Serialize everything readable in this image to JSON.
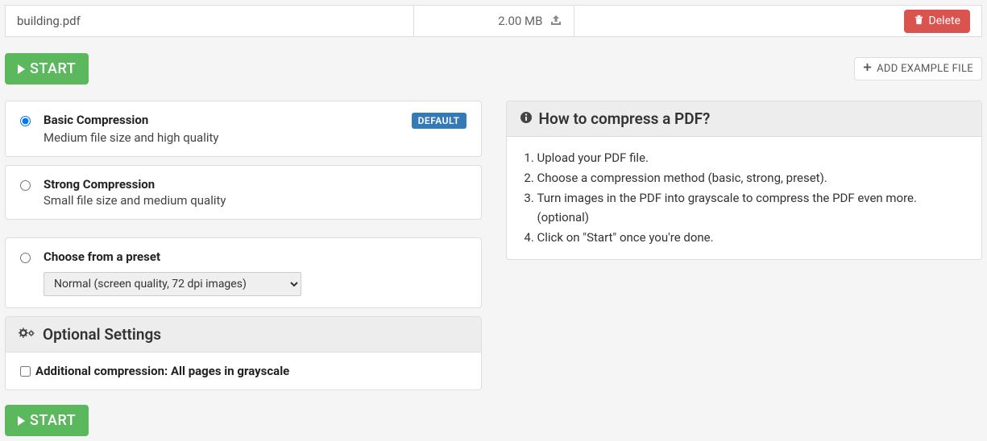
{
  "file": {
    "name": "building.pdf",
    "size": "2.00 MB",
    "delete_label": "Delete"
  },
  "start_button_label": "START",
  "add_example_label": "ADD EXAMPLE FILE",
  "compression": {
    "basic": {
      "title": "Basic Compression",
      "subtitle": "Medium file size and high quality",
      "badge": "DEFAULT",
      "checked": true
    },
    "strong": {
      "title": "Strong Compression",
      "subtitle": "Small file size and medium quality",
      "checked": false
    },
    "preset": {
      "title": "Choose from a preset",
      "selected": "Normal (screen quality, 72 dpi images)",
      "checked": false
    }
  },
  "optional": {
    "heading": "Optional Settings",
    "grayscale_label": "Additional compression: All pages in grayscale",
    "grayscale_checked": false
  },
  "help": {
    "heading": "How to compress a PDF?",
    "steps": [
      "Upload your PDF file.",
      "Choose a compression method (basic, strong, preset).",
      "Turn images in the PDF into grayscale to compress the PDF even more. (optional)",
      "Click on \"Start\" once you're done."
    ]
  }
}
